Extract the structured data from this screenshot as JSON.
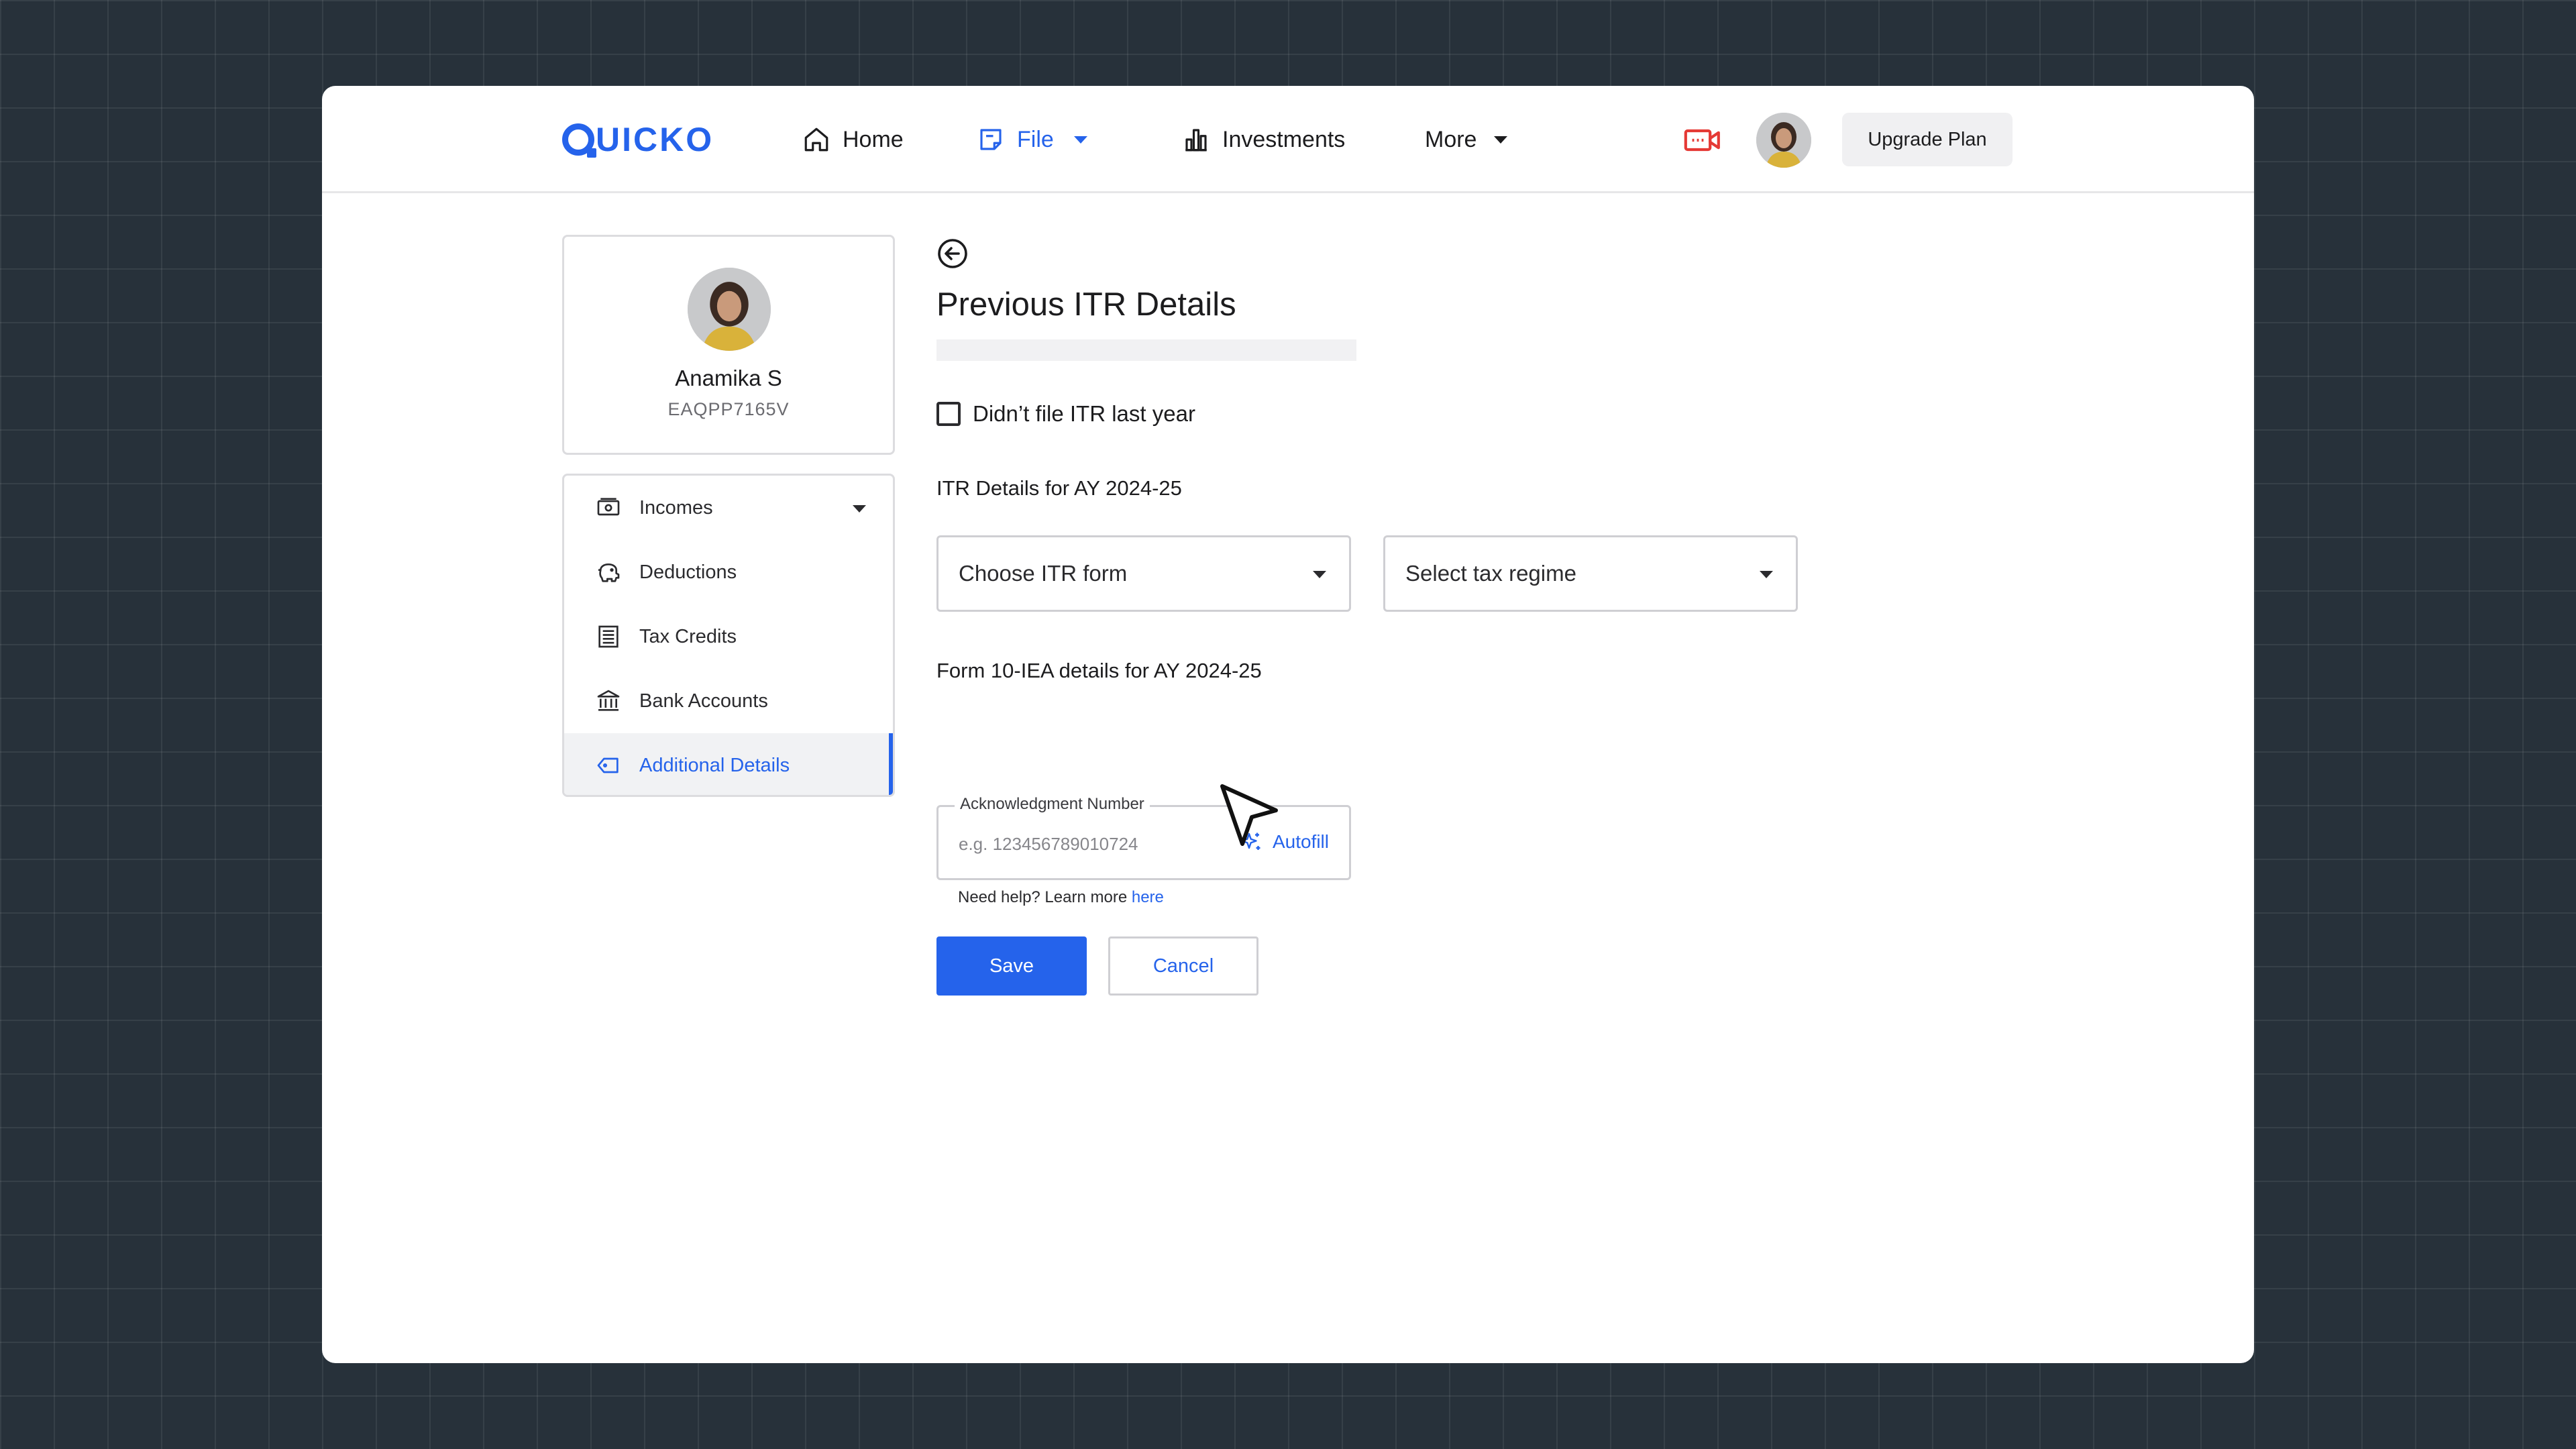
{
  "brand": {
    "logo_text": "UICKO",
    "accent": "#2563eb"
  },
  "nav": {
    "items": [
      {
        "label": "Home",
        "icon": "home-icon"
      },
      {
        "label": "File",
        "icon": "file-icon",
        "active": true
      },
      {
        "label": "Investments",
        "icon": "investments-icon"
      },
      {
        "label": "More"
      }
    ],
    "video_icon": "video-camera-icon",
    "upgrade_label": "Upgrade Plan"
  },
  "profile": {
    "name": "Anamika S",
    "pan": "EAQPP7165V"
  },
  "sidebar": {
    "items": [
      {
        "label": "Incomes",
        "icon": "wallet-icon"
      },
      {
        "label": "Deductions",
        "icon": "piggy-bank-icon"
      },
      {
        "label": "Tax Credits",
        "icon": "document-icon"
      },
      {
        "label": "Bank Accounts",
        "icon": "bank-icon"
      },
      {
        "label": "Additional Details",
        "icon": "tag-icon",
        "active": true
      }
    ]
  },
  "main": {
    "title": "Previous ITR Details",
    "checkbox_label": "Didn’t file ITR last year",
    "itr_section_label": "ITR Details for AY 2024-25",
    "itr_form_select": "Choose ITR form",
    "tax_regime_select": "Select tax regime",
    "form10_section_label": "Form 10-IEA details for AY 2024-25",
    "ack_label": "Acknowledgment Number",
    "ack_placeholder": "e.g. 123456789010724",
    "autofill_label": "Autofill",
    "help_text": "Need help? Learn more ",
    "help_link": "here",
    "save_label": "Save",
    "cancel_label": "Cancel"
  }
}
